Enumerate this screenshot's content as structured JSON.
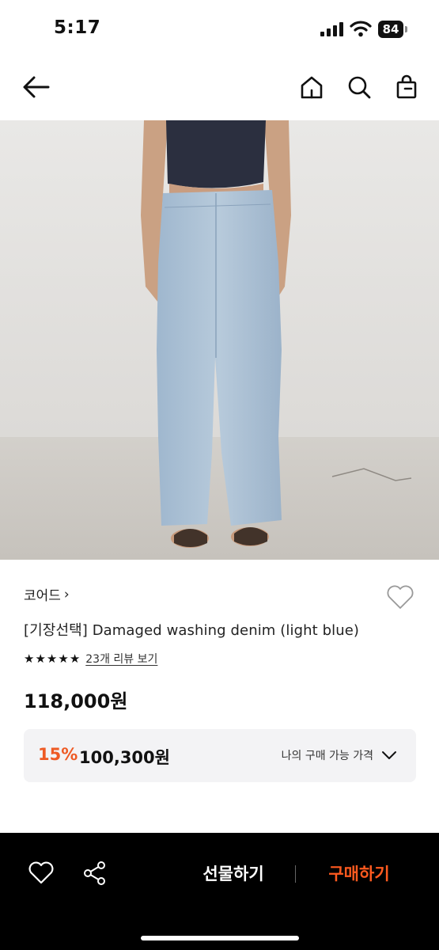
{
  "status_bar": {
    "time": "5:17",
    "battery": "84",
    "icons": [
      "cellular-signal-icon",
      "wifi-icon",
      "battery-icon"
    ]
  },
  "nav": {
    "icons": [
      "back-arrow-icon",
      "home-icon",
      "search-icon",
      "shopping-bag-icon"
    ]
  },
  "product": {
    "image_description_icon": "product-photo",
    "brand": "코어드",
    "brand_chevron": "›",
    "title": "[기장선택] Damaged washing denim (light blue)",
    "rating": 5,
    "rating_max": 5,
    "review_link": "23개 리뷰 보기",
    "price": "118,000원"
  },
  "discount": {
    "rate": "15%",
    "price": "100,300원",
    "my_price_label": "나의 구매 가능 가격"
  },
  "bottom_bar": {
    "gift_label": "선물하기",
    "buy_label": "구매하기"
  },
  "colors": {
    "accent": "#ee5a24",
    "buy_button_text": "#ff5a1f",
    "bottom_bar_bg": "#000000",
    "discount_box_bg": "#f3f3f5"
  }
}
